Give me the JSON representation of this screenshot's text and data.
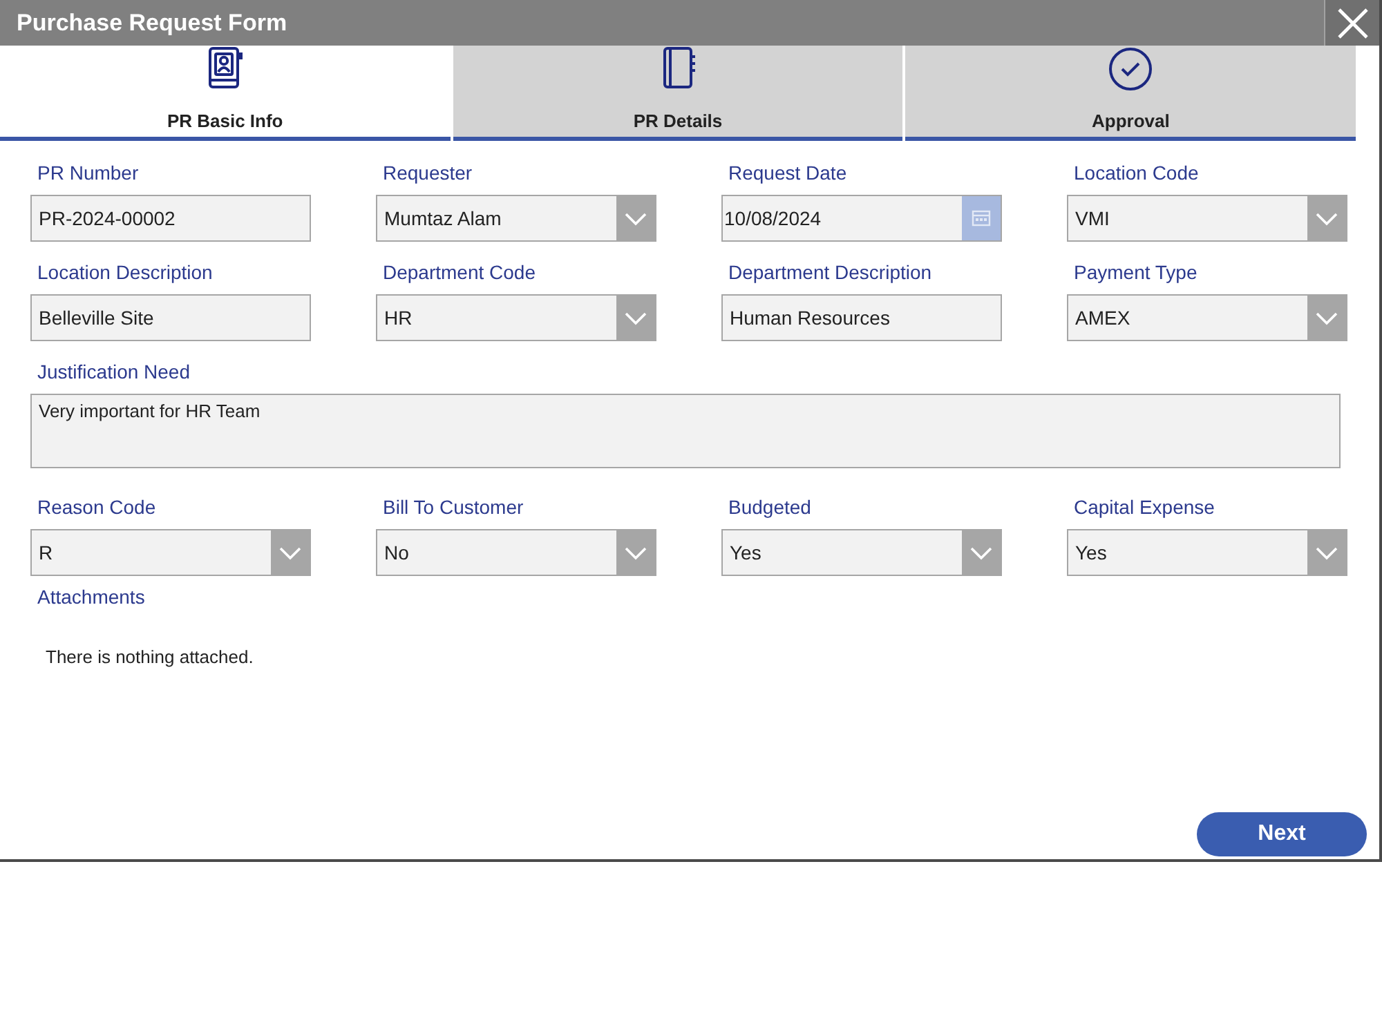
{
  "window": {
    "title": "Purchase Request Form"
  },
  "tabs": [
    {
      "label": "PR Basic Info",
      "selected": true
    },
    {
      "label": "PR Details",
      "selected": false
    },
    {
      "label": "Approval",
      "selected": false
    }
  ],
  "fields": [
    {
      "label": "PR Number",
      "kind": "text",
      "value": "PR-2024-00002"
    },
    {
      "label": "Requester",
      "kind": "dropdown",
      "value": "Mumtaz Alam"
    },
    {
      "label": "Request Date",
      "kind": "date",
      "value": "10/08/2024"
    },
    {
      "label": "Location Code",
      "kind": "dropdown",
      "value": "VMI"
    },
    {
      "label": "Location Description",
      "kind": "text",
      "value": "Belleville Site"
    },
    {
      "label": "Department Code",
      "kind": "dropdown",
      "value": "HR"
    },
    {
      "label": "Department Description",
      "kind": "text",
      "value": "Human Resources"
    },
    {
      "label": "Payment Type",
      "kind": "dropdown",
      "value": "AMEX"
    },
    {
      "label": "Justification Need",
      "kind": "textarea",
      "value": "Very important for HR Team"
    },
    {
      "label": "Reason Code",
      "kind": "dropdown",
      "value": "R"
    },
    {
      "label": "Bill To Customer",
      "kind": "dropdown",
      "value": "No"
    },
    {
      "label": "Budgeted",
      "kind": "dropdown",
      "value": "Yes"
    },
    {
      "label": "Capital Expense",
      "kind": "dropdown",
      "value": "Yes"
    }
  ],
  "attachments": {
    "label": "Attachments",
    "message": "There is nothing attached."
  },
  "next_button": {
    "label": "Next"
  }
}
